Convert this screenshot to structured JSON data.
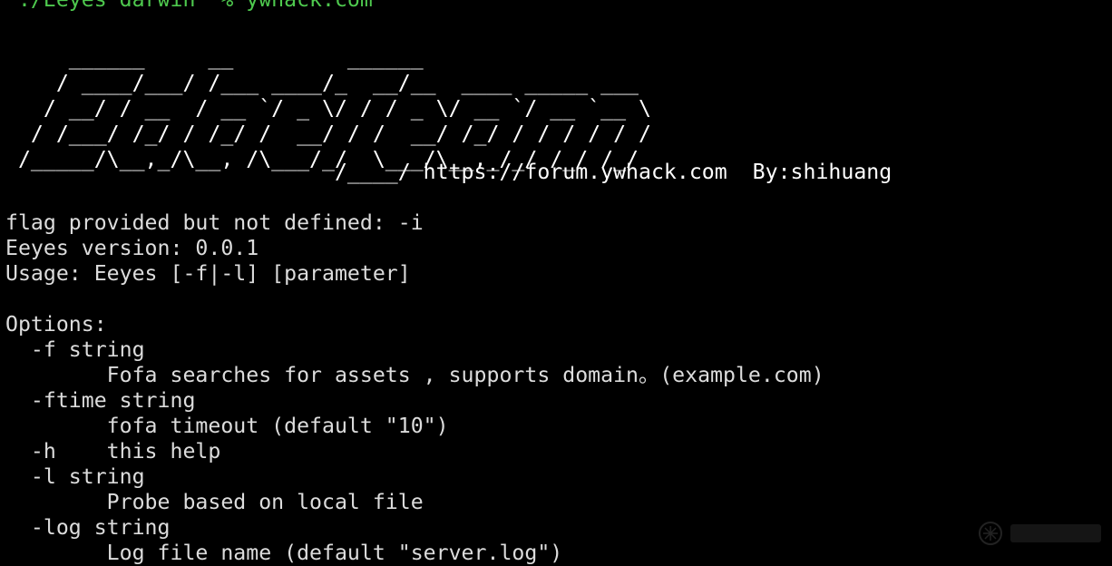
{
  "prompt": {
    "text": " ./Eeyes darwin  % ywhack.com"
  },
  "banner": {
    "lines": [
      "     ______     __         ______",
      "    / ____/___/ /___ ____/_  __/__  ____ _____ ___",
      "   / __/ / __  / __ `/ _ \\/ / / _ \\/ __ `/ __ `__ \\",
      "  / /___/ /_/ / /_/ /  __/ / /  __/ /_/ / / / / / /",
      " /_____/\\__,_/\\__, /\\___/_/  \\___/\\__,_/_/ /_/ /_/",
      "                          /____/ https://forum.ywhack.com  By:shihuang"
    ]
  },
  "output": {
    "error": "flag provided but not defined: -i",
    "version": "Eeyes version: 0.0.1",
    "usage": "Usage: Eeyes [-f|-l] [parameter]",
    "options_header": "Options:",
    "options": [
      "  -f string",
      "        Fofa searches for assets , supports domain。(example.com)",
      "  -ftime string",
      "        fofa timeout (default \"10\")",
      "  -h    this help",
      "  -l string",
      "        Probe based on local file",
      "  -log string",
      "        Log file name (default \"server.log\")"
    ]
  },
  "watermark": {
    "icon": "community-logo-icon",
    "text": "极风社区"
  },
  "colors": {
    "background": "#000000",
    "text": "#dcdcdc",
    "prompt": "#4ec94e",
    "banner": "#ffffff"
  }
}
